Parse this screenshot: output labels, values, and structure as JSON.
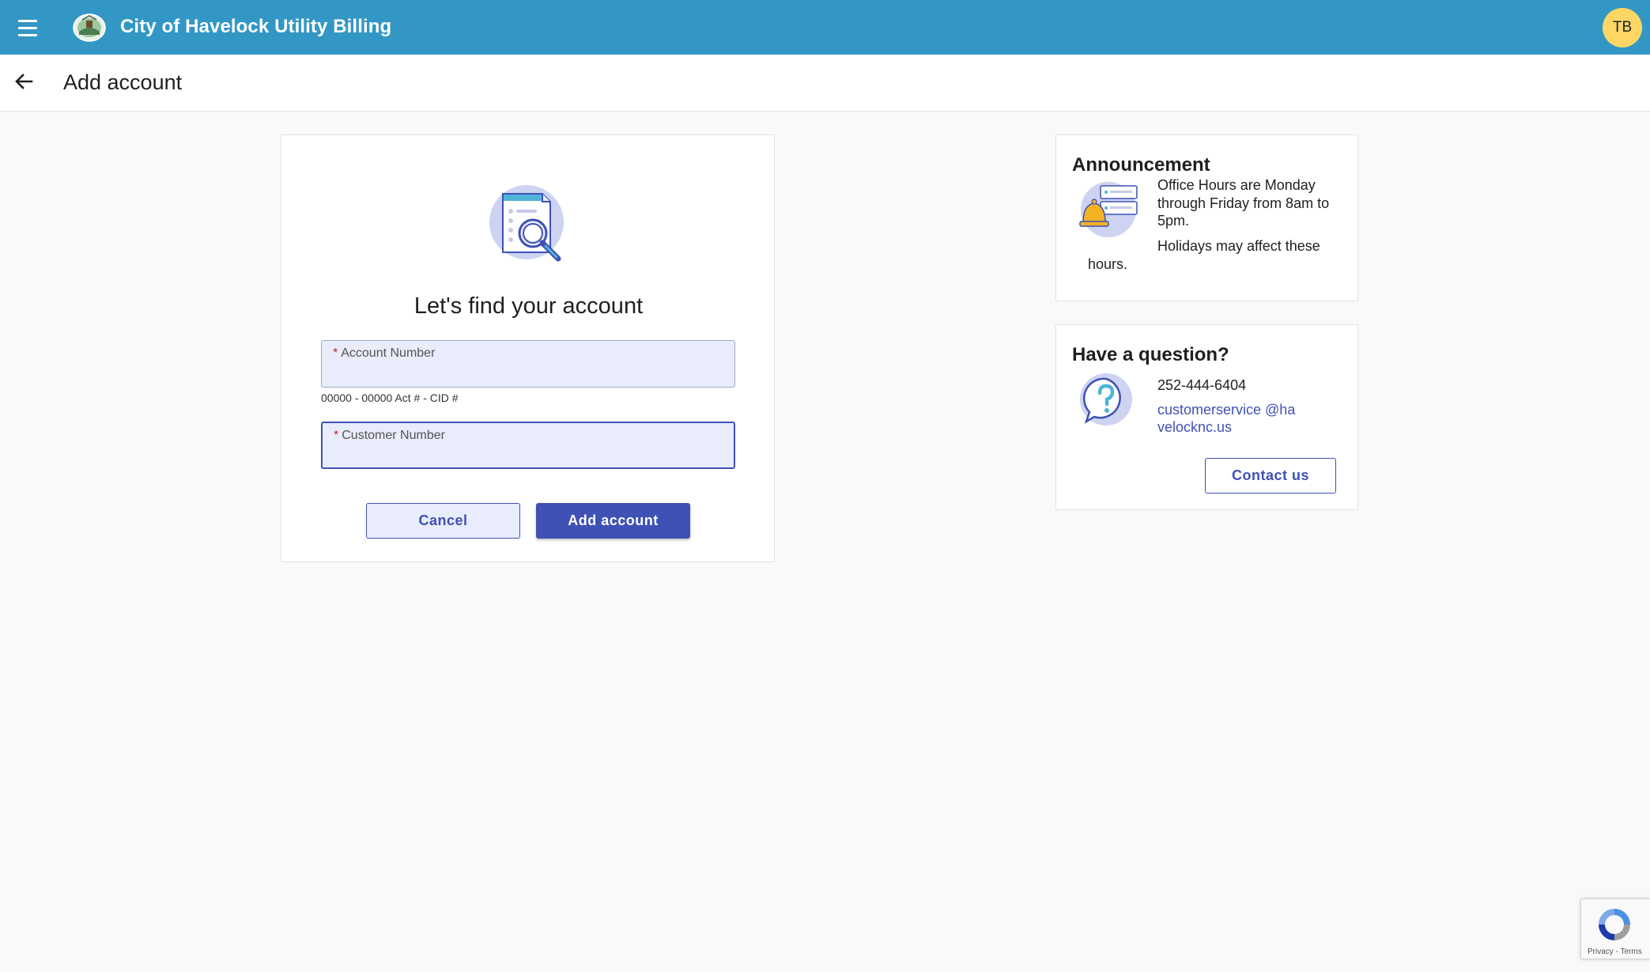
{
  "app": {
    "title": "City of Havelock Utility Billing",
    "user_initials": "TB",
    "brand_color": "#3297c4",
    "accent_color": "#3f51b5",
    "avatar_color": "#fdd663"
  },
  "subheader": {
    "title": "Add account"
  },
  "find_account": {
    "heading": "Let's find your account",
    "account_field": {
      "label": "Account Number",
      "value": "",
      "hint": "00000 - 00000 Act # - CID #"
    },
    "customer_field": {
      "label": "Customer Number",
      "value": ""
    },
    "cancel_label": "Cancel",
    "add_label": "Add account"
  },
  "announcement": {
    "title": "Announcement",
    "line1": "Office Hours are Monday through Friday from 8am to 5pm.",
    "line2": "Holidays may affect these",
    "line3": "hours."
  },
  "question": {
    "title": "Have a question?",
    "phone": "252-444-6404",
    "email": "customerservice @havelocknc.us",
    "contact_label": "Contact us"
  },
  "recaptcha": {
    "links": "Privacy - Terms"
  }
}
